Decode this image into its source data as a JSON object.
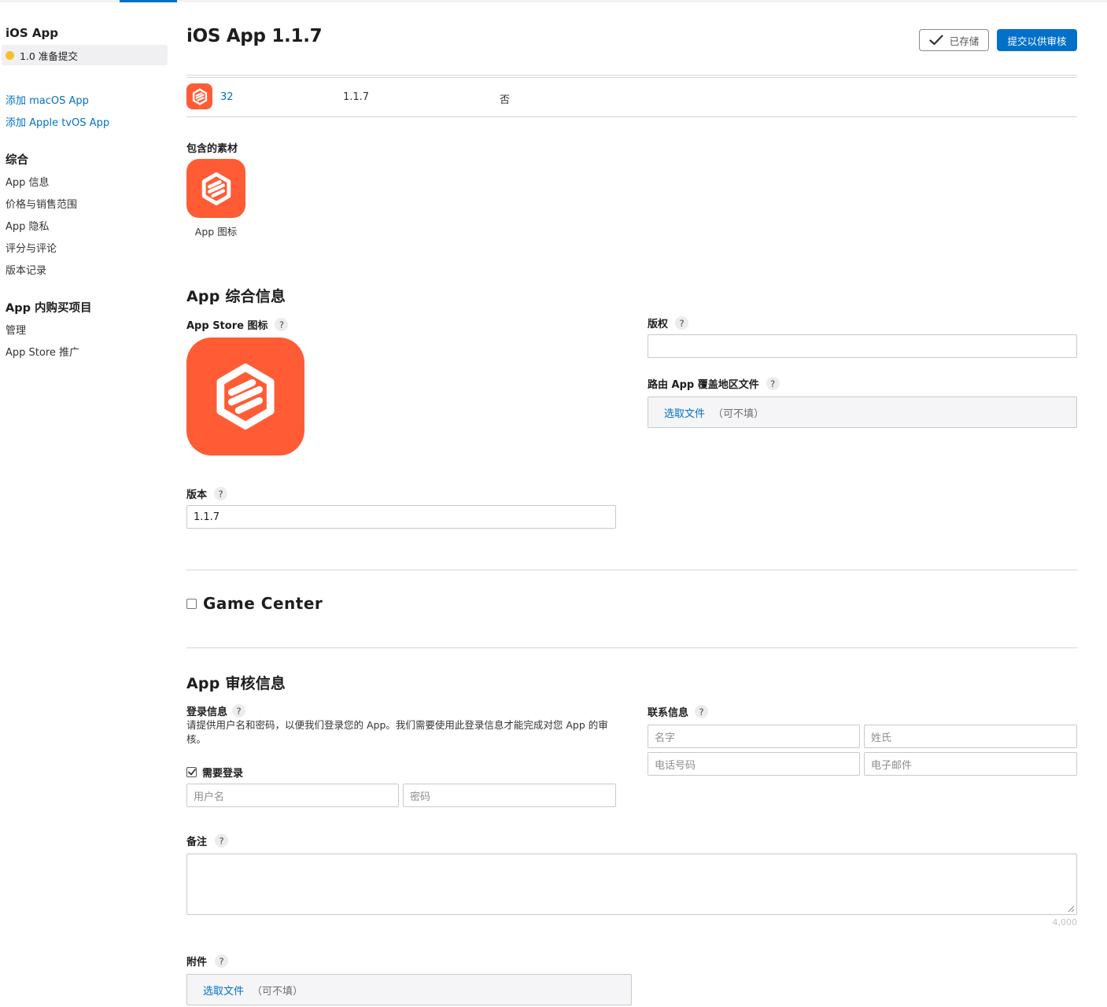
{
  "sidebar": {
    "app_title": "iOS App",
    "version_status": "1.0 准备提交",
    "add_links": [
      "添加 macOS App",
      "添加 Apple tvOS App"
    ],
    "general_heading": "综合",
    "general_items": [
      "App 信息",
      "价格与销售范围",
      "App 隐私",
      "评分与评论",
      "版本记录"
    ],
    "iap_heading": "App 内购买项目",
    "iap_items": [
      "管理",
      "App Store 推广"
    ]
  },
  "header": {
    "title": "iOS App 1.1.7",
    "saved_label": "已存储",
    "submit_label": "提交以供审核"
  },
  "build": {
    "number": "32",
    "version": "1.1.7",
    "flag": "否"
  },
  "assets": {
    "heading": "包含的素材",
    "icon_caption": "App 图标"
  },
  "general_info": {
    "title": "App 综合信息",
    "store_icon_label": "App Store 图标",
    "copyright_label": "版权",
    "copyright_value": "",
    "routing_label": "路由 App 覆盖地区文件",
    "routing_pick": "选取文件",
    "routing_optional": "（可不填）",
    "version_label": "版本",
    "version_value": "1.1.7"
  },
  "game_center": {
    "label": "Game Center",
    "checked": false
  },
  "review": {
    "title": "App 审核信息",
    "login_label": "登录信息",
    "login_desc": "请提供用户名和密码，以便我们登录您的 App。我们需要使用此登录信息才能完成对您 App 的审核。",
    "require_login_label": "需要登录",
    "require_login_checked": true,
    "username_placeholder": "用户名",
    "password_placeholder": "密码",
    "contact_label": "联系信息",
    "first_name_placeholder": "名字",
    "last_name_placeholder": "姓氏",
    "phone_placeholder": "电话号码",
    "email_placeholder": "电子邮件",
    "notes_label": "备注",
    "notes_counter": "4,000",
    "attachment_label": "附件",
    "attachment_pick": "选取文件",
    "attachment_optional": "（可不填）"
  },
  "colors": {
    "accent": "#0070c9",
    "brand_icon": "#ff5c35",
    "status_dot": "#f4c12c"
  }
}
